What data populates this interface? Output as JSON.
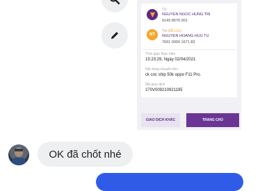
{
  "actions": {
    "top_icon": "search-icon",
    "edit_icon": "pencil-icon"
  },
  "receipt": {
    "sender_label": "Từ",
    "sender_name": "NGUYEN NGOC HUNG TRI",
    "sender_account": "0143 8676 001",
    "receiver_initials": "NT",
    "receiver_label": "Tới",
    "receiver_saved": "ĐÃ LƯU",
    "receiver_name": "NGUYEN HOANG HUU TU",
    "receiver_account": "7661 0000 1671 83",
    "time_label": "Thời gian thực hiện",
    "time_value": "15:23:29, Ngày 02/04/2021",
    "content_label": "Nội dung chuyển tiền",
    "content_value": "ck coc ship 50k oppo F11 Pro.",
    "tx_label": "Mã giao dịch",
    "tx_value": "270V009210921195",
    "btn_other": "GIAO DỊCH KHÁC",
    "btn_home": "TRANG CHỦ",
    "colors": {
      "brand": "#5c2a86",
      "button": "#6a3594"
    }
  },
  "chat": {
    "incoming_message": "OK đã chốt nhé",
    "outgoing_bubble_color": "#2f5be7"
  }
}
